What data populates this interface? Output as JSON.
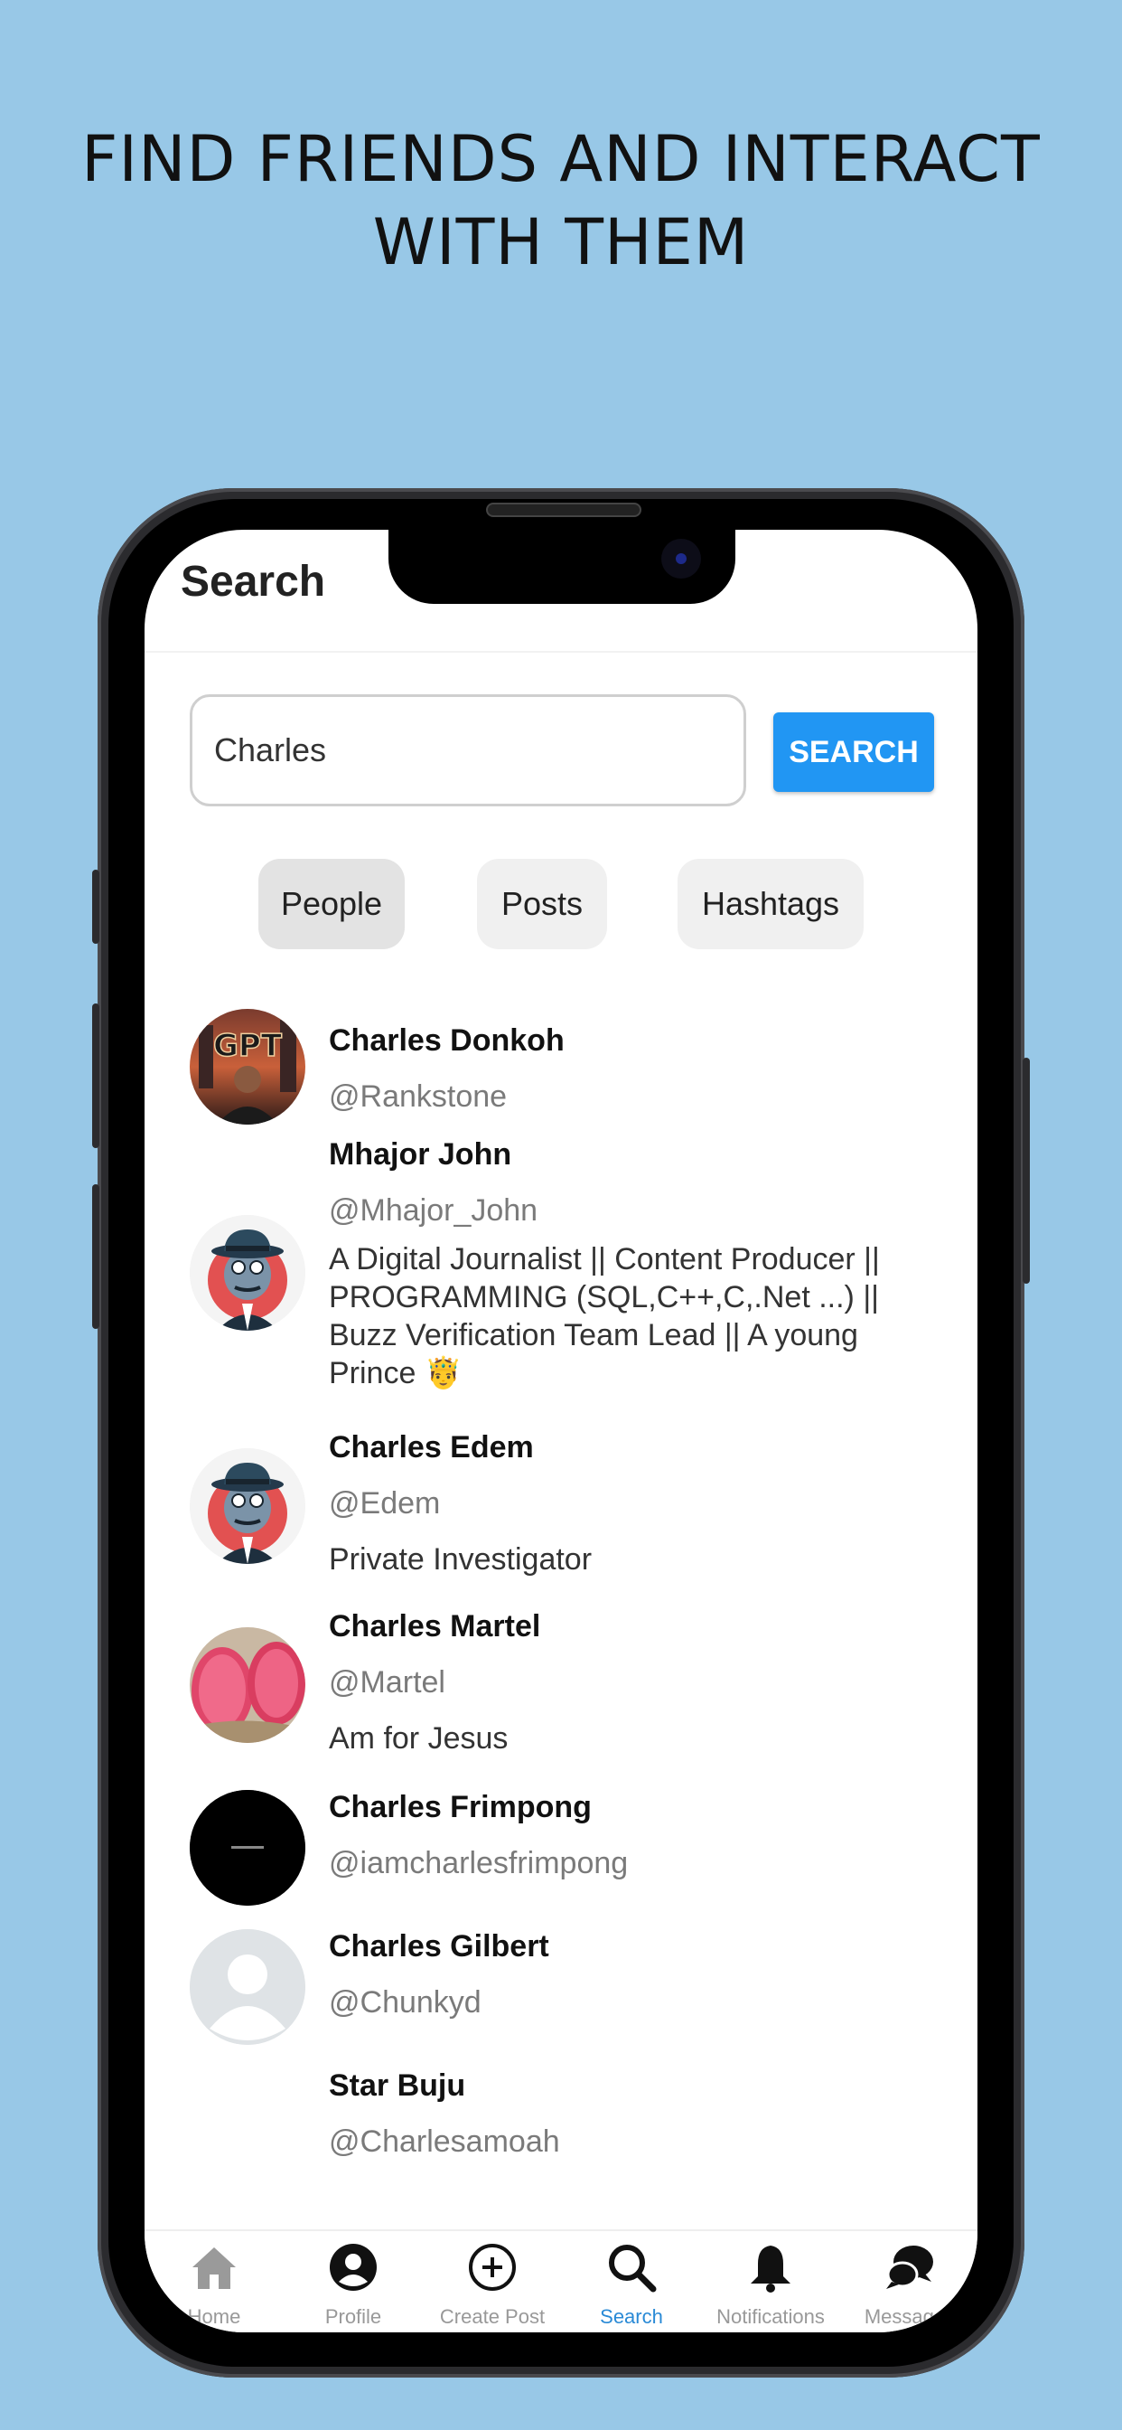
{
  "promo": {
    "line1": "FIND FRIENDS AND INTERACT",
    "line2": "WITH THEM"
  },
  "screen": {
    "title": "Search",
    "search": {
      "value": "Charles",
      "button_label": "SEARCH"
    },
    "tabs": [
      {
        "label": "People",
        "active": true
      },
      {
        "label": "Posts",
        "active": false
      },
      {
        "label": "Hashtags",
        "active": false
      }
    ],
    "results": [
      {
        "name": "Charles Donkoh",
        "handle": "@Rankstone",
        "bio": "",
        "avatar": "gpt-photo-avatar"
      },
      {
        "name": "Mhajor John",
        "handle": "@Mhajor_John",
        "bio": "A Digital Journalist || Content Producer || PROGRAMMING (SQL,C++,C,.Net ...) || Buzz Verification Team Lead || A young Prince 🤴",
        "avatar": "detective-avatar"
      },
      {
        "name": "Charles Edem",
        "handle": "@Edem",
        "bio": "Private Investigator",
        "avatar": "detective-avatar"
      },
      {
        "name": "Charles Martel",
        "handle": "@Martel",
        "bio": "Am for Jesus",
        "avatar": "watermelon-avatar"
      },
      {
        "name": "Charles Frimpong",
        "handle": "@iamcharlesfrimpong",
        "bio": "",
        "avatar": "black-avatar"
      },
      {
        "name": "Charles Gilbert",
        "handle": "@Chunkyd",
        "bio": "",
        "avatar": "default-avatar"
      },
      {
        "name": "Star Buju",
        "handle": "@Charlesamoah",
        "bio": "",
        "avatar": "none"
      }
    ],
    "nav": [
      {
        "label": "Home",
        "icon": "home-icon",
        "active": false
      },
      {
        "label": "Profile",
        "icon": "profile-icon",
        "active": false
      },
      {
        "label": "Create Post",
        "icon": "plus-circle-icon",
        "active": false
      },
      {
        "label": "Search",
        "icon": "search-icon",
        "active": true
      },
      {
        "label": "Notifications",
        "icon": "bell-icon",
        "active": false
      },
      {
        "label": "Messages",
        "icon": "chat-icon",
        "active": false
      }
    ]
  },
  "colors": {
    "background": "#98c8e7",
    "accent": "#2196f3",
    "active_nav": "#2a8ad6"
  }
}
